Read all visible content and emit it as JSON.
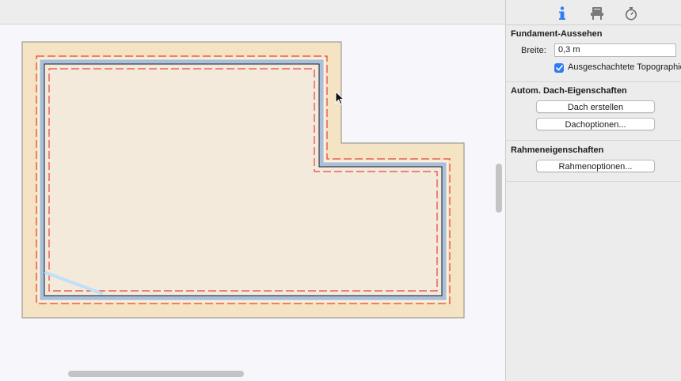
{
  "inspector": {
    "tabs": [
      {
        "icon": "info-icon",
        "active": true
      },
      {
        "icon": "furniture-icon",
        "active": false
      },
      {
        "icon": "stopwatch-icon",
        "active": false
      }
    ],
    "foundation": {
      "title": "Fundament-Aussehen",
      "width_label": "Breite:",
      "width_value": "0,3 m",
      "checkbox_label": "Ausgeschachtete Topographie",
      "checkbox_checked": true
    },
    "roof": {
      "title": "Autom. Dach-Eigenschaften",
      "create_button": "Dach erstellen",
      "options_button": "Dachoptionen..."
    },
    "frame": {
      "title": "Rahmeneigenschaften",
      "options_button": "Rahmenoptionen..."
    }
  },
  "colors": {
    "accent": "#2d7cf6",
    "foundation_fill": "#f5e4c3",
    "floor_fill": "#f3eadc",
    "dashed_line": "#e02020",
    "wall_blue": "#a9c0dc"
  }
}
